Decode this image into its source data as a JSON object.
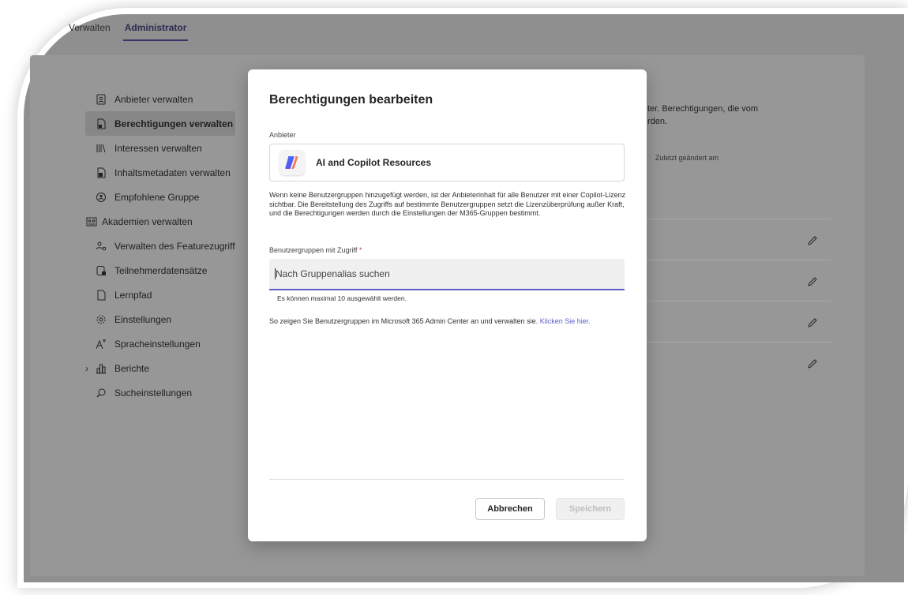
{
  "tabs": [
    {
      "label": "Verwalten"
    },
    {
      "label": "Administrator"
    }
  ],
  "sidebar": {
    "items": [
      {
        "label": "Anbieter verwalten",
        "icon": "provider-icon"
      },
      {
        "label": "Berechtigungen verwalten",
        "icon": "permission-doc-icon"
      },
      {
        "label": "Interessen verwalten",
        "icon": "library-icon"
      },
      {
        "label": "Inhaltsmetadaten verwalten",
        "icon": "metadata-doc-icon"
      },
      {
        "label": "Empfohlene Gruppe",
        "icon": "group-icon"
      },
      {
        "label": "Akademien verwalten",
        "icon": "academy-icon"
      },
      {
        "label": "Verwalten des Featurezugriffs",
        "icon": "people-settings-icon"
      },
      {
        "label": "Teilnehmerdatensätze",
        "icon": "records-icon"
      },
      {
        "label": "Lernpfad",
        "icon": "learning-path-icon"
      },
      {
        "label": "Einstellungen",
        "icon": "gear-icon"
      },
      {
        "label": "Spracheinstellungen",
        "icon": "language-icon"
      },
      {
        "label": "Berichte",
        "icon": "chart-icon"
      },
      {
        "label": "Sucheinstellungen",
        "icon": "search-settings-icon"
      }
    ]
  },
  "background": {
    "text_line1": "ter. Berechtigungen, die vom",
    "text_line2": "rden.",
    "column_header": "Zuletzt geändert am"
  },
  "modal": {
    "title": "Berechtigungen bearbeiten",
    "provider_label": "Anbieter",
    "provider_name": "AI and Copilot Resources",
    "description": "Wenn keine Benutzergruppen hinzugefügt werden, ist der Anbieterinhalt für alle Benutzer mit einer Copilot-Lizenz sichtbar. Die Bereitstellung des Zugriffs auf bestimmte Benutzergruppen setzt die Lizenzüberprüfung außer Kraft, und die Berechtigungen werden durch die Einstellungen der M365-Gruppen bestimmt.",
    "groups_label": "Benutzergruppen mit Zugriff",
    "required_marker": "*",
    "search_placeholder": "Nach Gruppenalias suchen",
    "hint": "Es können maximal 10 ausgewählt werden.",
    "info_text": "So zeigen Sie Benutzergruppen im Microsoft 365 Admin Center an und verwalten sie.",
    "info_link": "Klicken Sie hier.",
    "cancel_label": "Abbrechen",
    "save_label": "Speichern"
  },
  "colors": {
    "accent": "#5b5fc7",
    "overlay_bg": "#8f8f8f"
  }
}
